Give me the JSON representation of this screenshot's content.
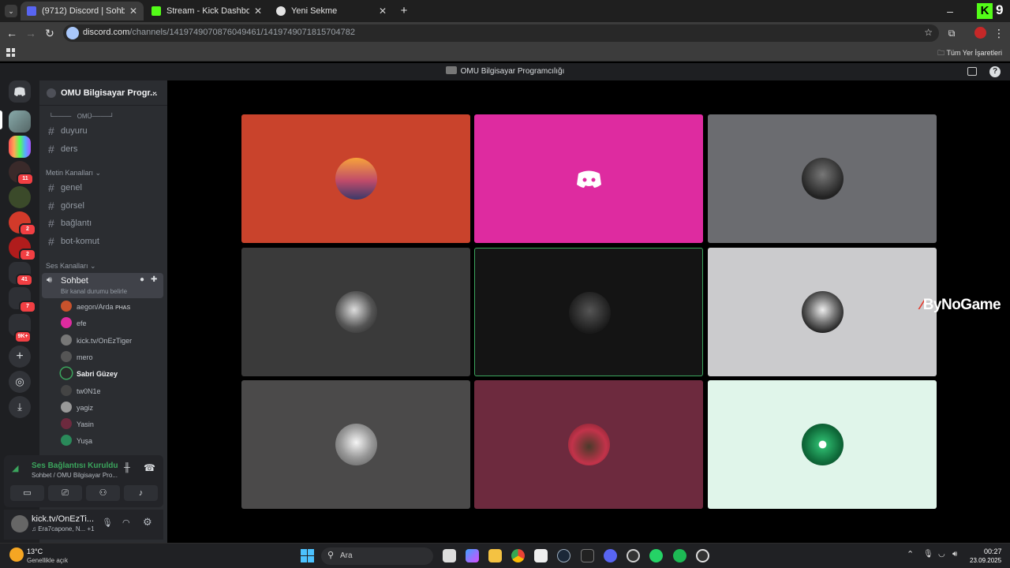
{
  "browser": {
    "tabs": [
      {
        "title": "(9712) Discord | Sohbet | O",
        "active": true
      },
      {
        "title": "Stream - Kick Dashboard",
        "active": false
      },
      {
        "title": "Yeni Sekme",
        "active": false
      }
    ],
    "url_domain": "discord.com",
    "url_path": "/channels/1419749070876049461/1419749071815704782",
    "bookmarks_label": "Tüm Yer İşaretleri",
    "corner_logo": "9"
  },
  "discord": {
    "window_title": "OMU Bilgisayar Programcılığı",
    "server_name": "OMU Bilgisayar Progr...",
    "divider_channel": "└────ﾠOMÜ────┘",
    "channels_top": [
      "duyuru",
      "ders"
    ],
    "text_category": "Metin Kanalları",
    "text_channels": [
      "genel",
      "görsel",
      "bağlantı",
      "bot-komut"
    ],
    "voice_category": "Ses Kanalları",
    "voice_channel": {
      "name": "Sohbet",
      "status": "Bir kanal durumu belirle"
    },
    "voice_users": [
      {
        "name": "aegon/Arda",
        "tag": "PHAS"
      },
      {
        "name": "efe"
      },
      {
        "name": "kick.tv/OnEzTiger"
      },
      {
        "name": "mero"
      },
      {
        "name": "Sabri Güzey"
      },
      {
        "name": "tw0N1e"
      },
      {
        "name": "yagiz"
      },
      {
        "name": "Yasin"
      },
      {
        "name": "Yuşa"
      }
    ],
    "server_badges": [
      "11",
      "2",
      "2",
      "41",
      "7",
      "9K+"
    ],
    "voice_panel": {
      "status": "Ses Bağlantısı Kuruldu",
      "location": "Sohbet / OMU Bilgisayar Pro..."
    },
    "user_panel": {
      "name": "kick.tv/OnEzTi...",
      "activity": "♫ Era7capone, N... +1"
    },
    "watermark": "ByNoGame"
  },
  "taskbar": {
    "weather_temp": "13°C",
    "weather_desc": "Genellikle açık",
    "search_label": "Ara",
    "time": "00:27",
    "date": "23.09.2025"
  },
  "colors": {
    "discord_blurple": "#5865f2",
    "speaking_green": "#3ba55d",
    "tile_orange": "#c9432c",
    "tile_pink": "#de2ba0",
    "tile_maroon": "#6d2a3e",
    "tile_mint": "#e0f5ea"
  }
}
